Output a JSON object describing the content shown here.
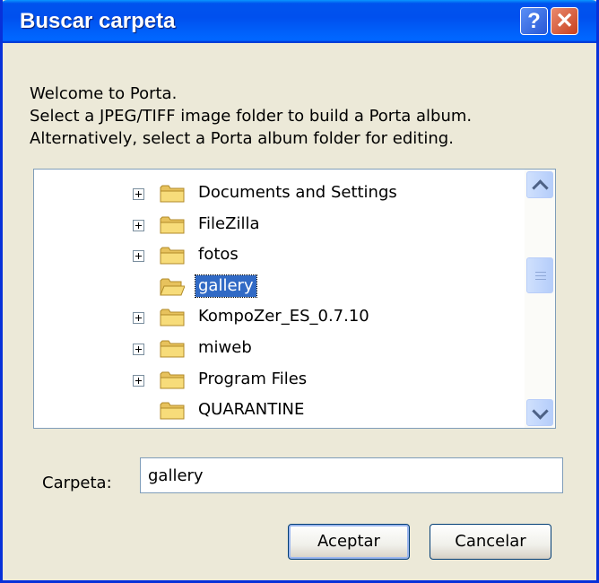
{
  "window": {
    "title": "Buscar carpeta",
    "help_label": "?",
    "close_label": "✕"
  },
  "instructions": [
    "Welcome to Porta.",
    "Select a JPEG/TIFF image folder to build a Porta album.",
    "Alternatively, select a Porta album folder for editing."
  ],
  "tree": {
    "items": [
      {
        "label": "Documents and Settings",
        "expandable": true
      },
      {
        "label": "FileZilla",
        "expandable": true
      },
      {
        "label": "fotos",
        "expandable": true
      },
      {
        "label": "gallery",
        "expandable": false,
        "selected": true
      },
      {
        "label": "KompoZer_ES_0.7.10",
        "expandable": true
      },
      {
        "label": "miweb",
        "expandable": true
      },
      {
        "label": "Program Files",
        "expandable": true
      },
      {
        "label": "QUARANTINE",
        "expandable": false
      }
    ]
  },
  "folder_field": {
    "label": "Carpeta:",
    "value": "gallery"
  },
  "buttons": {
    "ok": "Aceptar",
    "cancel": "Cancelar"
  },
  "colors": {
    "titlebar": "#0055ea",
    "selection": "#316ac5",
    "face": "#ece9d8"
  }
}
